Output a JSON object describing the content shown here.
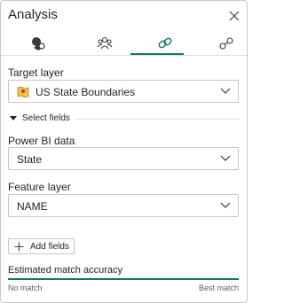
{
  "panel": {
    "title": "Analysis"
  },
  "icons": {
    "close": "close-icon",
    "tabs": [
      "layer-pin-icon",
      "people-group-icon",
      "link-icon",
      "relationship-icon"
    ]
  },
  "tabs": {
    "active_index": 2
  },
  "target_layer": {
    "label": "Target layer",
    "value": "US State Boundaries",
    "icon": "map-layer-icon"
  },
  "select_fields": {
    "label": "Select fields",
    "expanded": true
  },
  "power_bi": {
    "label": "Power BI data",
    "value": "State"
  },
  "feature_layer": {
    "label": "Feature layer",
    "value": "NAME"
  },
  "add_fields": {
    "label": "Add fields"
  },
  "accuracy": {
    "label": "Estimated match accuracy",
    "min_label": "No match",
    "max_label": "Best match",
    "level": 1.0
  },
  "colors": {
    "accent": "#117865",
    "border": "#c8c6c4",
    "map_icon": "#e8c24a"
  }
}
